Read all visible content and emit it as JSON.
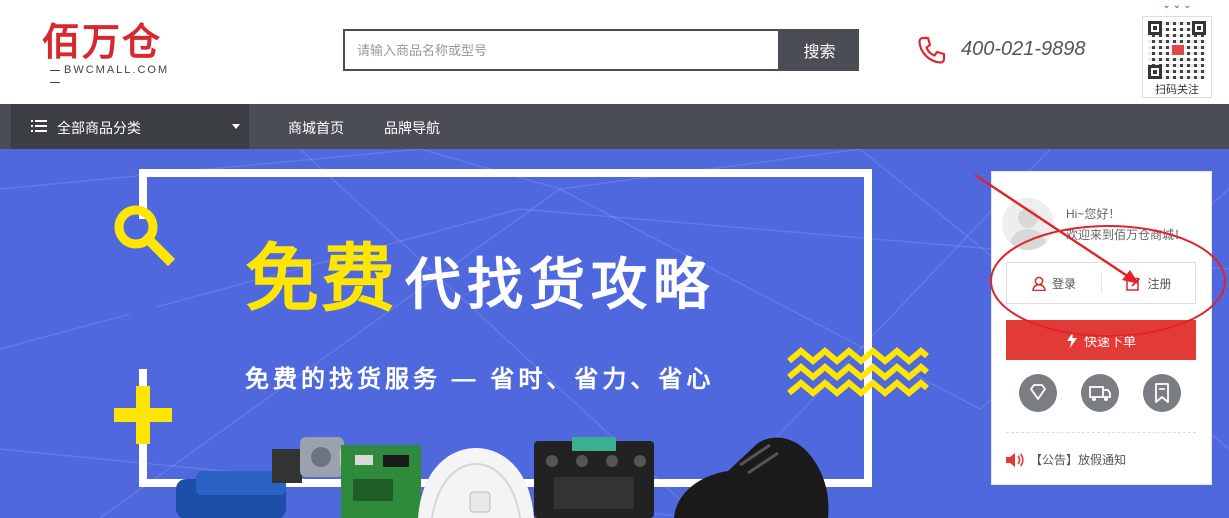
{
  "header": {
    "logo_text": "佰万仓",
    "logo_sub": "BWCMALL.COM",
    "search_placeholder": "请输入商品名称或型号",
    "search_button": "搜索",
    "phone": "400-021-9898",
    "qr_label": "扫码关注"
  },
  "nav": {
    "category_label": "全部商品分类",
    "links": [
      {
        "label": "商城首页"
      },
      {
        "label": "品牌导航"
      }
    ]
  },
  "banner": {
    "headline_yellow": "免费",
    "headline_white": "代找货攻略",
    "subline": "免费的找货服务 — 省时、省力、省心"
  },
  "user_card": {
    "greeting": "Hi~您好！",
    "welcome": "欢迎来到佰万仓商城！",
    "login_label": "登录",
    "register_label": "注册",
    "quick_order_label": "快速下单",
    "notice": "【公告】放假通知"
  },
  "icons": {
    "phone": "phone-icon",
    "menu": "menu-icon",
    "search": "magnifier-icon",
    "user": "user-icon",
    "edit": "edit-icon",
    "bolt": "lightning-icon",
    "diamond": "diamond-icon",
    "truck": "truck-icon",
    "bookmark": "bookmark-icon",
    "speaker": "speaker-icon"
  },
  "colors": {
    "brand_red": "#d8282f",
    "nav_bg": "#4a4d53",
    "banner_blue": "#4f68de",
    "accent_yellow": "#ffe600",
    "quick_order_red": "#e23a36"
  }
}
